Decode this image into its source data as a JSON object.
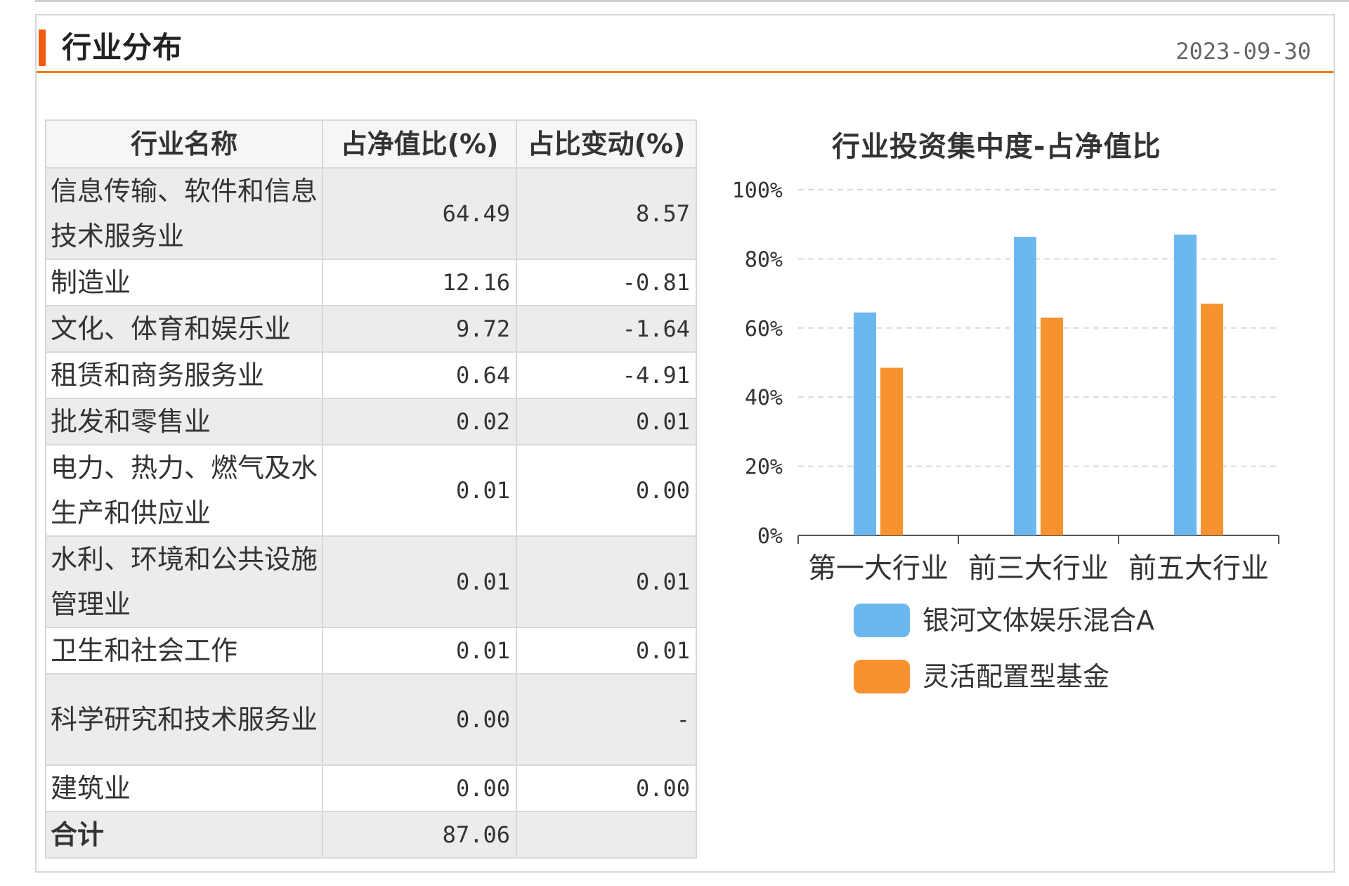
{
  "panel": {
    "title": "行业分布",
    "date": "2023-09-30"
  },
  "table": {
    "headers": [
      "行业名称",
      "占净值比(%)",
      "占比变动(%)"
    ],
    "rows": [
      {
        "name": "信息传输、软件和信息技术服务业",
        "ratio": "64.49",
        "change": "8.57",
        "change_sign": "pos"
      },
      {
        "name": "制造业",
        "ratio": "12.16",
        "change": "-0.81",
        "change_sign": "neg"
      },
      {
        "name": "文化、体育和娱乐业",
        "ratio": "9.72",
        "change": "-1.64",
        "change_sign": "neg"
      },
      {
        "name": "租赁和商务服务业",
        "ratio": "0.64",
        "change": "-4.91",
        "change_sign": "neg"
      },
      {
        "name": "批发和零售业",
        "ratio": "0.02",
        "change": "0.01",
        "change_sign": "pos"
      },
      {
        "name": "电力、热力、燃气及水生产和供应业",
        "ratio": "0.01",
        "change": "0.00",
        "change_sign": "zero"
      },
      {
        "name": "水利、环境和公共设施管理业",
        "ratio": "0.01",
        "change": "0.01",
        "change_sign": "pos"
      },
      {
        "name": "卫生和社会工作",
        "ratio": "0.01",
        "change": "0.01",
        "change_sign": "pos"
      },
      {
        "name": "科学研究和技术服务业",
        "ratio": "0.00",
        "change": "-",
        "change_sign": "zero"
      },
      {
        "name": "建筑业",
        "ratio": "0.00",
        "change": "0.00",
        "change_sign": "zero"
      }
    ],
    "total": {
      "name": "合计",
      "ratio": "87.06",
      "change": ""
    }
  },
  "colors": {
    "accent": "#f25a14",
    "positive": "#e00000",
    "negative": "#2a9a00",
    "series_a": "#6cb8ee",
    "series_b": "#f7922e"
  },
  "chart_data": {
    "type": "bar",
    "title": "行业投资集中度-占净值比",
    "categories": [
      "第一大行业",
      "前三大行业",
      "前五大行业"
    ],
    "series": [
      {
        "name": "银河文体娱乐混合A",
        "values": [
          64.49,
          86.37,
          87.03
        ]
      },
      {
        "name": "灵活配置型基金",
        "values": [
          48.5,
          63.0,
          67.0
        ]
      }
    ],
    "ylim": [
      0,
      100
    ],
    "yticks": [
      "0%",
      "20%",
      "40%",
      "60%",
      "80%",
      "100%"
    ],
    "grid": true,
    "legend": "bottom"
  }
}
